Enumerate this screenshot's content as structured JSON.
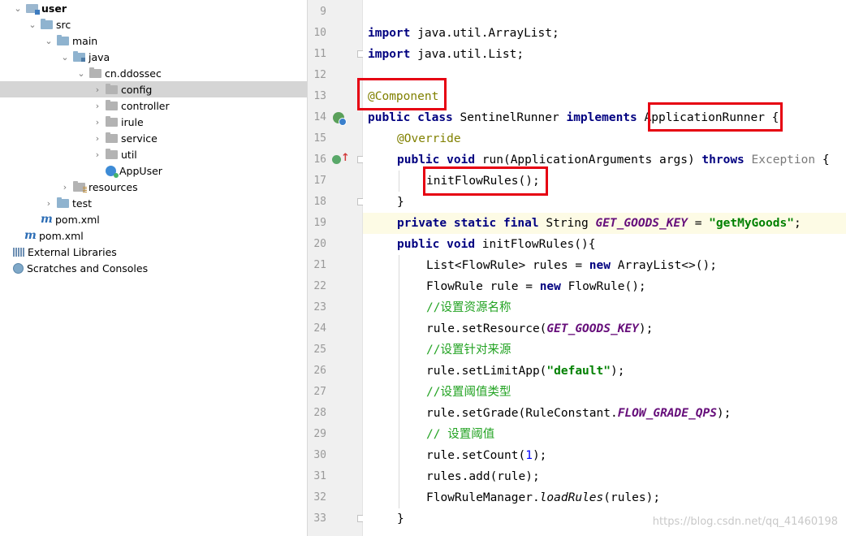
{
  "tree": {
    "items": [
      {
        "label": "user",
        "arrow": "⌄",
        "icon": "folder-module-icon",
        "bold": true
      },
      {
        "label": "src",
        "arrow": "⌄",
        "icon": "folder-icon"
      },
      {
        "label": "main",
        "arrow": "⌄",
        "icon": "folder-icon"
      },
      {
        "label": "java",
        "arrow": "⌄",
        "icon": "source-folder-icon"
      },
      {
        "label": "cn.ddossec",
        "arrow": "⌄",
        "icon": "package-icon"
      },
      {
        "label": "config",
        "arrow": "›",
        "icon": "package-icon"
      },
      {
        "label": "controller",
        "arrow": "›",
        "icon": "package-icon"
      },
      {
        "label": "irule",
        "arrow": "›",
        "icon": "package-icon"
      },
      {
        "label": "service",
        "arrow": "›",
        "icon": "package-icon"
      },
      {
        "label": "util",
        "arrow": "›",
        "icon": "package-icon"
      },
      {
        "label": "AppUser",
        "arrow": "",
        "icon": "spring-class-icon"
      },
      {
        "label": "resources",
        "arrow": "›",
        "icon": "resources-folder-icon"
      },
      {
        "label": "test",
        "arrow": "›",
        "icon": "folder-icon"
      },
      {
        "label": "pom.xml",
        "arrow": "",
        "icon": "maven-icon"
      },
      {
        "label": "pom.xml",
        "arrow": "",
        "icon": "maven-icon"
      },
      {
        "label": "External Libraries",
        "arrow": "",
        "icon": "libraries-icon"
      },
      {
        "label": "Scratches and Consoles",
        "arrow": "",
        "icon": "scratches-icon"
      }
    ]
  },
  "editor": {
    "line_numbers": [
      "9",
      "10",
      "11",
      "12",
      "13",
      "14",
      "15",
      "16",
      "17",
      "18",
      "19",
      "20",
      "21",
      "22",
      "23",
      "24",
      "25",
      "26",
      "27",
      "28",
      "29",
      "30",
      "31",
      "32",
      "33"
    ],
    "lines": {
      "l10_kw": "import",
      "l10_rest": " java.util.ArrayList;",
      "l11_kw": "import",
      "l11_rest": " java.util.List;",
      "l13_ann": "@Component",
      "l14_kw1": "public",
      "l14_sp1": " ",
      "l14_kw2": "class",
      "l14_name": " SentinelRunner ",
      "l14_kw3": "implements",
      "l14_sp2": " ",
      "l14_iface": "ApplicationRunner",
      "l14_end": " {",
      "l15_ann": "@Override",
      "l16_kw1": "public",
      "l16_sp1": " ",
      "l16_kw2": "void",
      "l16_sig": " run(ApplicationArguments args) ",
      "l16_kw3": "throws",
      "l16_sp2": " ",
      "l16_exc": "Exception",
      "l16_end": " {",
      "l17_call": "initFlowRules();",
      "l18_brace": "}",
      "l19_kw1": "private",
      "l19_sp1": " ",
      "l19_kw2": "static",
      "l19_sp2": " ",
      "l19_kw3": "final",
      "l19_type": " String ",
      "l19_const": "GET_GOODS_KEY",
      "l19_eq": " = ",
      "l19_str": "\"getMyGoods\"",
      "l19_end": ";",
      "l20_kw1": "public",
      "l20_sp1": " ",
      "l20_kw2": "void",
      "l20_rest": " initFlowRules(){",
      "l21_a": "List<FlowRule> rules = ",
      "l21_kw": "new",
      "l21_b": " ArrayList<>();",
      "l22_a": "FlowRule rule = ",
      "l22_kw": "new",
      "l22_b": " FlowRule();",
      "l23_cmt": "//设置资源名称",
      "l24_a": "rule.setResource(",
      "l24_const": "GET_GOODS_KEY",
      "l24_b": ");",
      "l25_cmt": "//设置针对来源",
      "l26_a": "rule.setLimitApp(",
      "l26_str": "\"default\"",
      "l26_b": ");",
      "l27_cmt": "//设置阈值类型",
      "l28_a": "rule.setGrade(RuleConstant.",
      "l28_const": "FLOW_GRADE_QPS",
      "l28_b": ");",
      "l29_cmt": "// 设置阈值",
      "l30_a": "rule.setCount(",
      "l30_num": "1",
      "l30_b": ");",
      "l31_a": "rules.add(rule);",
      "l32_a": "FlowRuleManager.",
      "l32_static": "loadRules",
      "l32_b": "(rules);",
      "l33_brace": "}"
    }
  },
  "watermark": "https://blog.csdn.net/qq_41460198"
}
